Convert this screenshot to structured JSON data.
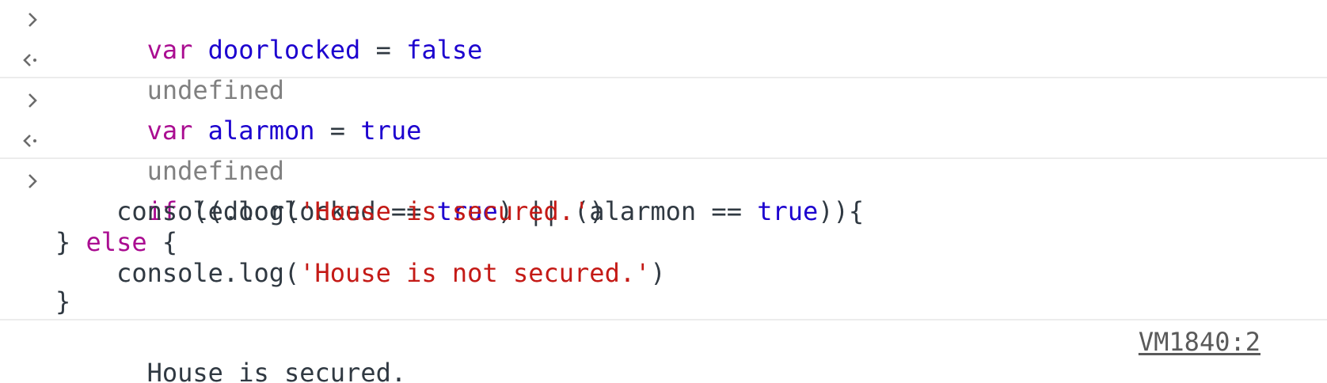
{
  "entries": [
    {
      "input": {
        "kw": "var",
        "name": "doorlocked",
        "op": "=",
        "value": "false"
      },
      "result": "undefined"
    },
    {
      "input": {
        "kw": "var",
        "name": "alarmon",
        "op": "=",
        "value": "true"
      },
      "result": "undefined"
    }
  ],
  "if_block": {
    "line1": {
      "kw_if": "if",
      "part1": "((doorlocked == ",
      "true1": "true",
      "part2": ") || (alarmon == ",
      "true2": "true",
      "part3": ")){"
    },
    "line2": {
      "indent": "    ",
      "call": "console.log(",
      "str": "'House is secured.'",
      "close": ")"
    },
    "line3": {
      "open": "} ",
      "kw_else": "else",
      "brace": " {"
    },
    "line4": {
      "indent": "    ",
      "call": "console.log(",
      "str": "'House is not secured.'",
      "close": ")"
    },
    "line5": {
      "close": "}"
    }
  },
  "log_output": {
    "message": "House is secured.",
    "source": "VM1840:2"
  },
  "icons": {
    "prompt": "chevron-right-icon",
    "result": "return-arrow-icon"
  },
  "colors": {
    "keyword": "#aa0d91",
    "identifier": "#1c00cf",
    "string": "#c41a16",
    "result_gray": "#808080",
    "separator": "#ececec"
  }
}
